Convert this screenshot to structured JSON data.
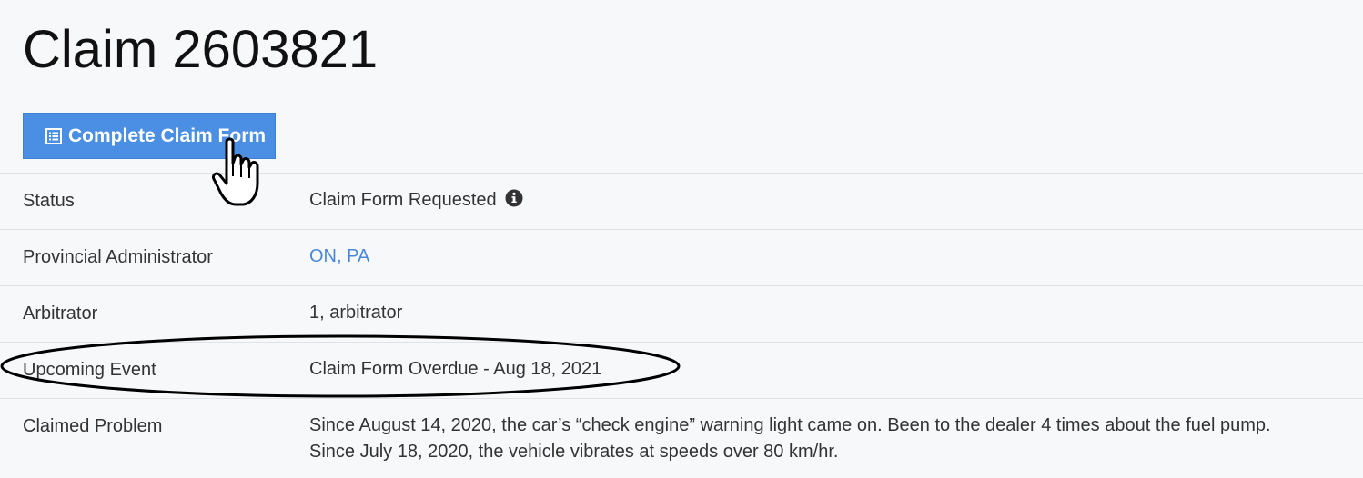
{
  "header": {
    "title": "Claim 2603821"
  },
  "actions": {
    "complete_claim_form_label": "Complete Claim Form",
    "complete_claim_form_icon": "list-icon"
  },
  "details": {
    "status_label": "Status",
    "status_value": "Claim Form Requested",
    "status_icon": "info-circle-icon",
    "administrator_label": "Provincial Administrator",
    "administrator_value": "ON, PA",
    "arbitrator_label": "Arbitrator",
    "arbitrator_value": "1, arbitrator",
    "upcoming_event_label": "Upcoming Event",
    "upcoming_event_value": "Claim Form Overdue - Aug 18, 2021",
    "claimed_problem_label": "Claimed Problem",
    "claimed_problem_lines": [
      "Since August 14, 2020, the car’s “check engine” warning light came on. Been to the dealer 4 times about the fuel pump.",
      "Since July 18, 2020, the vehicle vibrates at speeds over 80 km/hr."
    ]
  },
  "colors": {
    "accent": "#4a8fe3",
    "link": "#4a86d8",
    "background": "#f7f8fa",
    "divider": "#dfe2e6"
  }
}
